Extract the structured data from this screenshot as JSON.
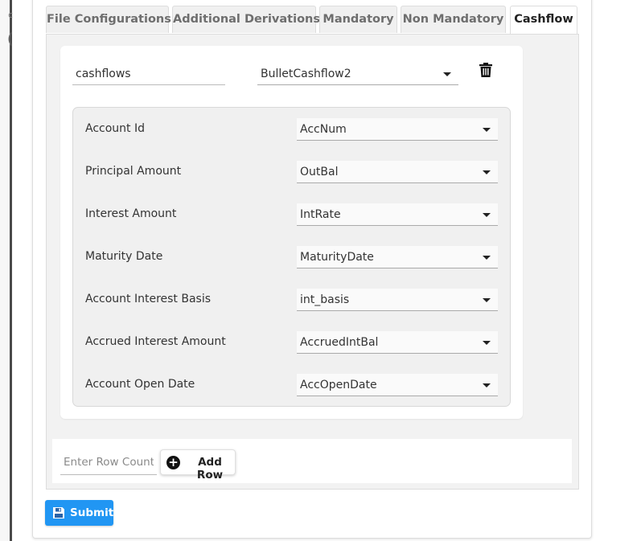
{
  "tabs": [
    {
      "label": "File Configurations"
    },
    {
      "label": "Additional Derivations"
    },
    {
      "label": "Mandatory"
    },
    {
      "label": "Non Mandatory"
    },
    {
      "label": "Cashflow",
      "active": true
    }
  ],
  "cashflow": {
    "name_value": "cashflows",
    "type_value": "BulletCashflow2",
    "mappings": [
      {
        "label": "Account Id",
        "value": "AccNum"
      },
      {
        "label": "Principal Amount",
        "value": "OutBal"
      },
      {
        "label": "Interest Amount",
        "value": "IntRate"
      },
      {
        "label": "Maturity Date",
        "value": "MaturityDate"
      },
      {
        "label": "Account Interest Basis",
        "value": "int_basis"
      },
      {
        "label": "Accrued Interest Amount",
        "value": "AccruedIntBal"
      },
      {
        "label": "Account Open Date",
        "value": "AccOpenDate"
      }
    ]
  },
  "footer": {
    "row_count_placeholder": "Enter Row Count",
    "add_row_label": "Add Row"
  },
  "submit_label": "Submit",
  "colors": {
    "primary": "#2196f3",
    "panel": "#f2f2f2"
  }
}
